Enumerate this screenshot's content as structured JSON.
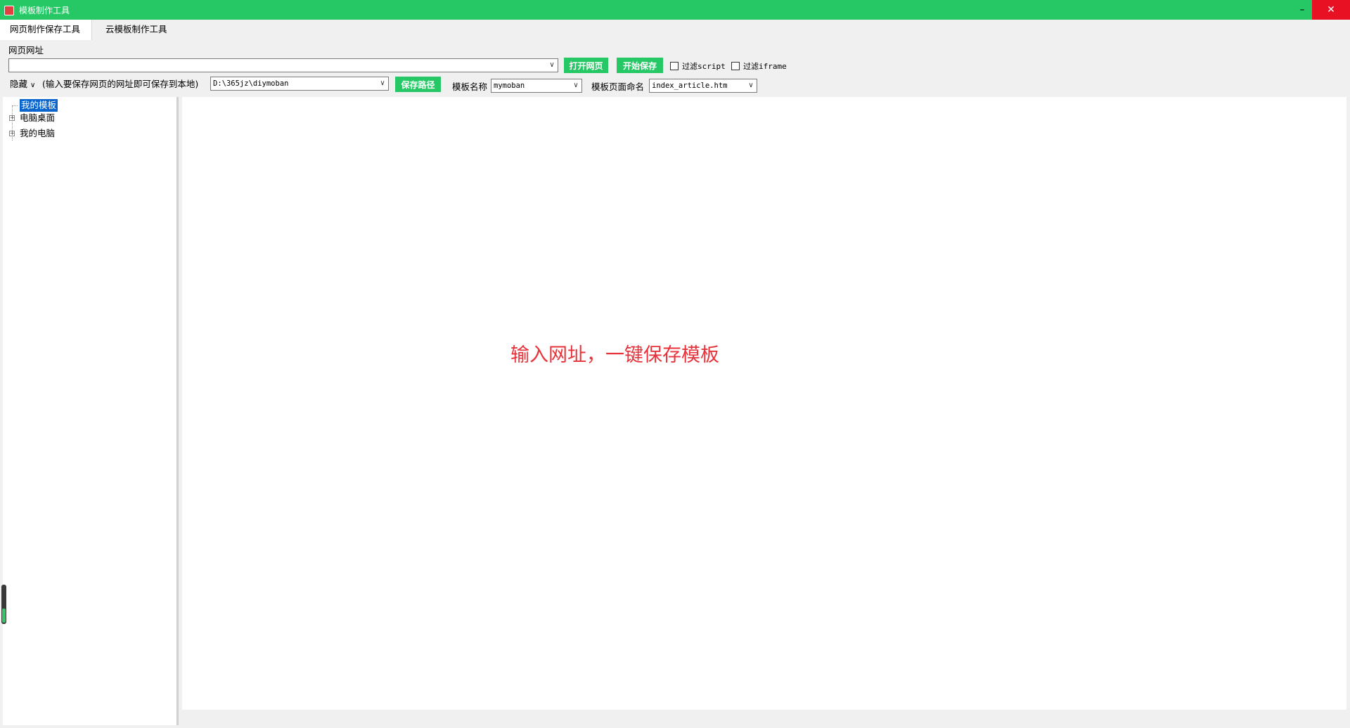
{
  "window": {
    "title": "模板制作工具",
    "minimize": "–",
    "close": "✕"
  },
  "tabs": [
    {
      "label": "网页制作保存工具",
      "active": true
    },
    {
      "label": "云模板制作工具",
      "active": false
    }
  ],
  "url_section": {
    "label": "网页网址",
    "value": ""
  },
  "buttons": {
    "open_page": "打开网页",
    "start_save": "开始保存",
    "save_path": "保存路径"
  },
  "filters": [
    {
      "label": "过滤script",
      "checked": false
    },
    {
      "label": "过滤iframe",
      "checked": false
    }
  ],
  "row2": {
    "hide_label": "隐藏",
    "hint": "(输入要保存网页的网址即可保存到本地)",
    "path_value": "D:\\365jz\\diymoban",
    "template_name_label": "模板名称",
    "template_name_value": "mymoban",
    "page_name_label": "模板页面命名",
    "page_name_value": "index_article.htm"
  },
  "tree": [
    {
      "label": "我的模板",
      "selected": true,
      "expandable": false
    },
    {
      "label": "电脑桌面",
      "selected": false,
      "expandable": true
    },
    {
      "label": "我的电脑",
      "selected": false,
      "expandable": true
    }
  ],
  "content": {
    "hint": "输入网址，一键保存模板"
  },
  "colors": {
    "accent": "#25c865",
    "hint": "#e8323a",
    "selection": "#0a64ce",
    "close": "#e81123"
  },
  "icons": {
    "expander": "plus-box-icon",
    "dropdown": "chevron-down-icon"
  }
}
